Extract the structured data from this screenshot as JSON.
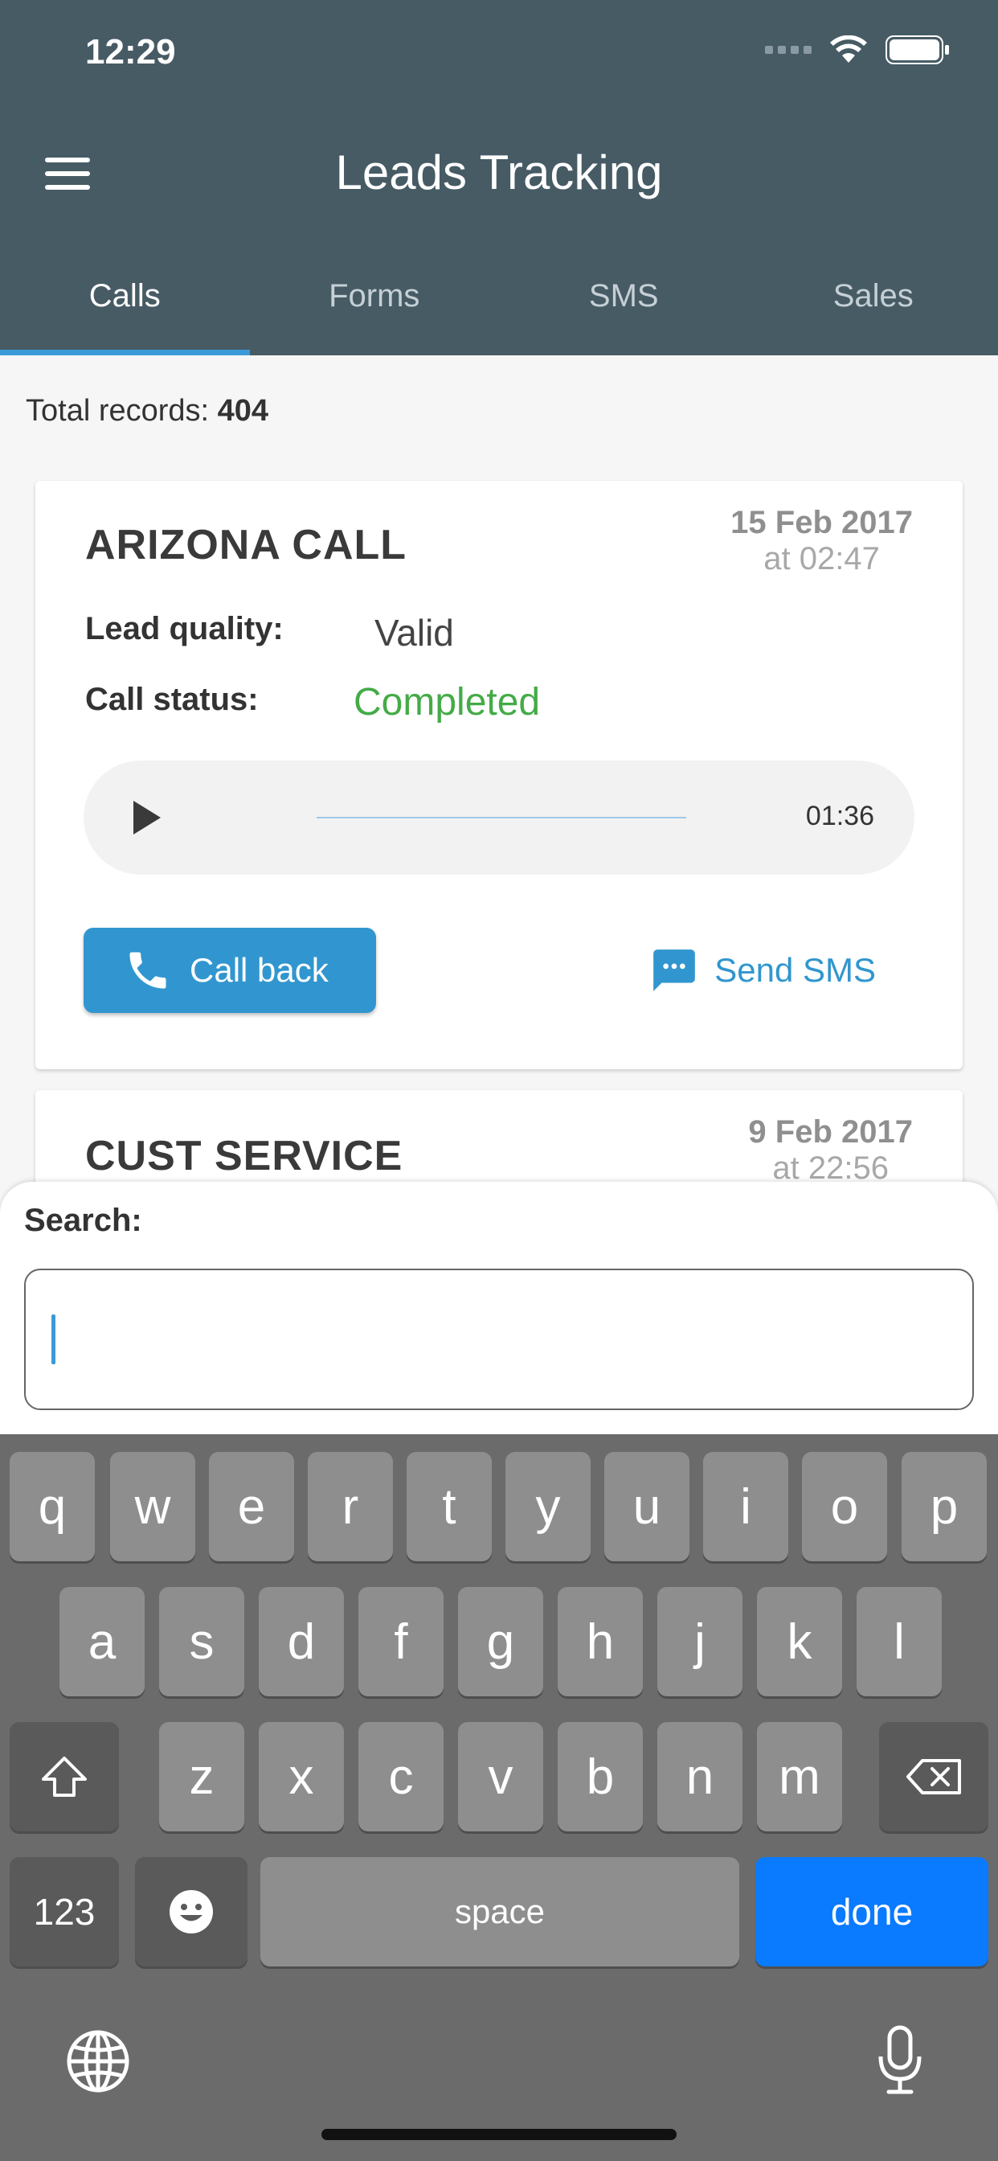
{
  "status_bar": {
    "time": "12:29"
  },
  "header": {
    "title": "Leads Tracking",
    "tabs": [
      {
        "label": "Calls",
        "active": true
      },
      {
        "label": "Forms",
        "active": false
      },
      {
        "label": "SMS",
        "active": false
      },
      {
        "label": "Sales",
        "active": false
      }
    ]
  },
  "summary": {
    "label": "Total records:",
    "count": "404"
  },
  "cards": [
    {
      "title": "ARIZONA CALL",
      "date": "15 Feb 2017",
      "time": "at 02:47",
      "lead_quality_label": "Lead quality:",
      "lead_quality": "Valid",
      "call_status_label": "Call status:",
      "call_status": "Completed",
      "duration": "01:36",
      "callback_label": "Call back",
      "sms_label": "Send SMS"
    },
    {
      "title": "CUST SERVICE",
      "date": "9 Feb 2017",
      "time": "at 22:56"
    }
  ],
  "search": {
    "label": "Search:",
    "value": ""
  },
  "keyboard": {
    "row1": [
      "q",
      "w",
      "e",
      "r",
      "t",
      "y",
      "u",
      "i",
      "o",
      "p"
    ],
    "row2": [
      "a",
      "s",
      "d",
      "f",
      "g",
      "h",
      "j",
      "k",
      "l"
    ],
    "row3": [
      "z",
      "x",
      "c",
      "v",
      "b",
      "n",
      "m"
    ],
    "numbers_label": "123",
    "space_label": "space",
    "done_label": "done"
  },
  "colors": {
    "header": "#475b65",
    "accent": "#3196cf",
    "status_ok": "#44ab47",
    "done_key": "#0a7aff"
  }
}
